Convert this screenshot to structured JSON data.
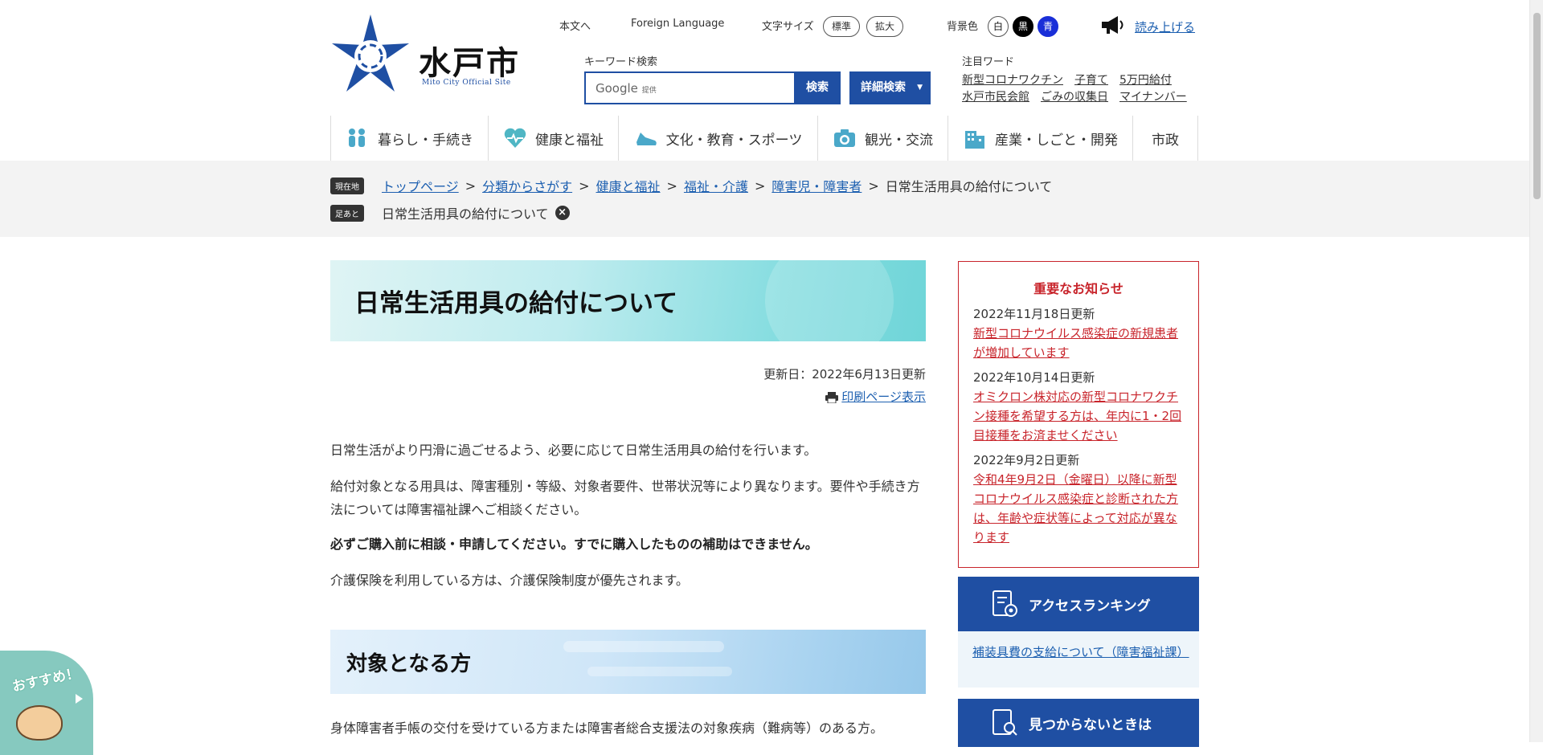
{
  "header": {
    "city_name": "水戸市",
    "city_sub": "Mito City Official Site",
    "util": {
      "to_main": "本文へ",
      "foreign": "Foreign Language",
      "font_size_label": "文字サイズ",
      "font_standard": "標準",
      "font_large": "拡大",
      "bg_label": "背景色",
      "bg_white": "白",
      "bg_black": "黒",
      "bg_blue": "青",
      "read_aloud": "読み上げる"
    },
    "search": {
      "label": "キーワード検索",
      "google": "Google",
      "google_suffix": "提供",
      "search_btn": "検索",
      "advanced_btn": "詳細検索"
    },
    "trend": {
      "label": "注目ワード",
      "row1": [
        "新型コロナワクチン",
        "子育て",
        "5万円給付"
      ],
      "row2": [
        "水戸市民会館",
        "ごみの収集日",
        "マイナンバー"
      ]
    }
  },
  "gnav": [
    {
      "label": "暮らし・手続き",
      "icon": "people-icon"
    },
    {
      "label": "健康と福祉",
      "icon": "heart-icon"
    },
    {
      "label": "文化・教育・スポーツ",
      "icon": "shoe-icon"
    },
    {
      "label": "観光・交流",
      "icon": "camera-icon"
    },
    {
      "label": "産業・しごと・開発",
      "icon": "building-icon"
    },
    {
      "label": "市政",
      "icon": ""
    }
  ],
  "breadcrumb": {
    "tag": "現在地",
    "items": [
      "トップページ",
      "分類からさがす",
      "健康と福祉",
      "福祉・介護",
      "障害児・障害者"
    ],
    "current": "日常生活用具の給付について",
    "sep": ">"
  },
  "footmark": {
    "tag": "足あと",
    "item": "日常生活用具の給付について",
    "close": "×"
  },
  "main": {
    "title": "日常生活用具の給付について",
    "updated": "更新日：2022年6月13日更新",
    "print": "印刷ページ表示",
    "p1": "日常生活がより円滑に過ごせるよう、必要に応じて日常生活用具の給付を行います。",
    "p2": "給付対象となる用具は、障害種別・等級、対象者要件、世帯状況等により異なります。要件や手続き方法については障害福祉課へご相談ください。",
    "p3": "必ずご購入前に相談・申請してください。すでに購入したものの補助はできません。",
    "p4": "介護保険を利用している方は、介護保険制度が優先されます。",
    "section_title": "対象となる方",
    "p5": "身体障害者手帳の交付を受けている方または障害者総合支援法の対象疾病（難病等）のある方。"
  },
  "notice": {
    "title": "重要なお知らせ",
    "items": [
      {
        "date": "2022年11月18日更新",
        "text": "新型コロナウイルス感染症の新規患者が増加しています"
      },
      {
        "date": "2022年10月14日更新",
        "text": "オミクロン株対応の新型コロナワクチン接種を希望する方は、年内に1・2回目接種をお済ませください"
      },
      {
        "date": "2022年9月2日更新",
        "text": "令和4年9月2日（金曜日）以降に新型コロナウイルス感染症と診断された方は、年齢や症状等によって対応が異なります"
      }
    ]
  },
  "ranking": {
    "title": "アクセスランキング",
    "item": "補装具費の支給について（障害福祉課）"
  },
  "find": {
    "title": "見つからないときは"
  },
  "mascot": {
    "text": "おすすめ！"
  },
  "colors": {
    "brand_blue": "#1f4fa3",
    "notice_red": "#c8242b",
    "link": "#1c5fb0"
  }
}
